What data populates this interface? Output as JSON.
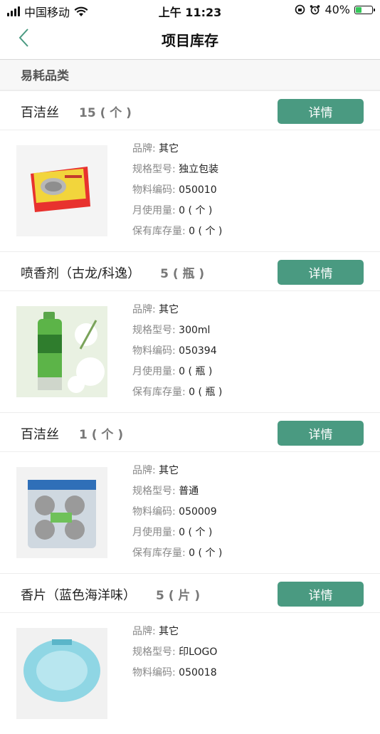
{
  "status_bar": {
    "carrier": "中国移动",
    "time": "上午 11:23",
    "battery": "40%",
    "battery_level": 0.4
  },
  "nav": {
    "title": "项目库存"
  },
  "section": {
    "title": "易耗品类"
  },
  "detail_label": "详情",
  "labels": {
    "brand": "品牌: ",
    "spec": "规格型号: ",
    "code": "物料编码: ",
    "monthly": "月使用量: ",
    "stock": "保有库存量: "
  },
  "items": [
    {
      "name": "百洁丝",
      "qty": "15 ( 个 )",
      "brand": "其它",
      "spec": "独立包装",
      "code": "050010",
      "monthly": "0 ( 个 )",
      "stock": "0 ( 个 )"
    },
    {
      "name": "喷香剂（古龙/科逸）",
      "qty": "5 ( 瓶 )",
      "brand": "其它",
      "spec": "300ml",
      "code": "050394",
      "monthly": "0 ( 瓶 )",
      "stock": "0 ( 瓶 )"
    },
    {
      "name": "百洁丝",
      "qty": "1 ( 个 )",
      "brand": "其它",
      "spec": "普通",
      "code": "050009",
      "monthly": "0 ( 个 )",
      "stock": "0 ( 个 )"
    },
    {
      "name": "香片（蓝色海洋味）",
      "qty": "5 ( 片 )",
      "brand": "其它",
      "spec": "印LOGO",
      "code": "050018",
      "monthly": "",
      "stock": ""
    }
  ]
}
